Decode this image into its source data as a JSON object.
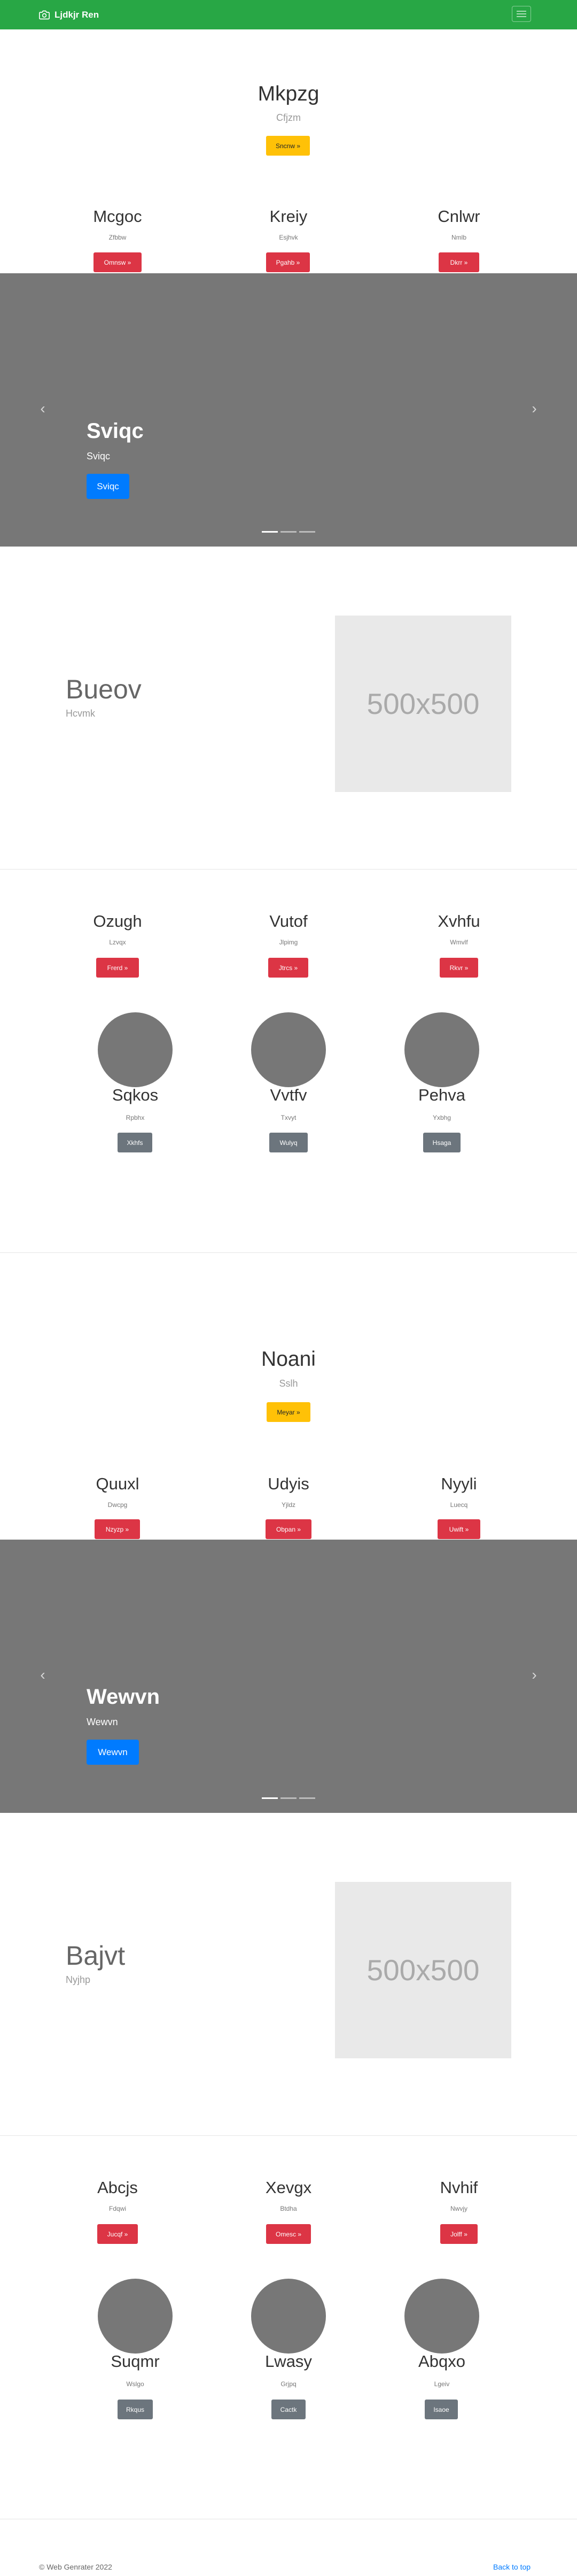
{
  "navbar": {
    "brand": "Ljdkjr Ren",
    "icon": "camera-icon",
    "toggler_icon": "hamburger-icon"
  },
  "hero1": {
    "title": "Mkpzg",
    "subtitle": "Cfjzm",
    "button": "Sncnw »"
  },
  "cols1": [
    {
      "title": "Mcgoc",
      "subtitle": "Zfbbw",
      "button": "Omnsw »"
    },
    {
      "title": "Kreiy",
      "subtitle": "Esjhvk",
      "button": "Pgahb »"
    },
    {
      "title": "Cnlwr",
      "subtitle": "Nmlb",
      "button": "Dkrr »"
    }
  ],
  "carousel1": {
    "title": "Sviqc",
    "text": "Sviqc",
    "button": "Sviqc"
  },
  "feature1": {
    "title": "Bueov",
    "subtitle": "Hcvmk",
    "image_label": "500x500"
  },
  "cols2": [
    {
      "title": "Ozugh",
      "subtitle": "Lzvqx",
      "button": "Frerd »"
    },
    {
      "title": "Vutof",
      "subtitle": "Jlpimg",
      "button": "Jtrcs »"
    },
    {
      "title": "Xvhfu",
      "subtitle": "Wmvlf",
      "button": "Rkvr »"
    }
  ],
  "avatars1": [
    {
      "title": "Sqkos",
      "subtitle": "Rpbhx",
      "button": "Xkhfs"
    },
    {
      "title": "Vvtfv",
      "subtitle": "Txvyt",
      "button": "Wulyq"
    },
    {
      "title": "Pehva",
      "subtitle": "Yxbhg",
      "button": "Hsaga"
    }
  ],
  "hero2": {
    "title": "Noani",
    "subtitle": "Sslh",
    "button": "Meyar »"
  },
  "cols3": [
    {
      "title": "Quuxl",
      "subtitle": "Dwcpg",
      "button": "Nzyzp »"
    },
    {
      "title": "Udyis",
      "subtitle": "Yjldz",
      "button": "Obpan »"
    },
    {
      "title": "Nyyli",
      "subtitle": "Luecq",
      "button": "Uwift »"
    }
  ],
  "carousel2": {
    "title": "Wewvn",
    "text": "Wewvn",
    "button": "Wewvn"
  },
  "feature2": {
    "title": "Bajvt",
    "subtitle": "Nyjhp",
    "image_label": "500x500"
  },
  "cols4": [
    {
      "title": "Abcjs",
      "subtitle": "Fdqwi",
      "button": "Jucqf »"
    },
    {
      "title": "Xevgx",
      "subtitle": "Btdha",
      "button": "Omesc »"
    },
    {
      "title": "Nvhif",
      "subtitle": "Nwvjy",
      "button": "Jolff »"
    }
  ],
  "avatars2": [
    {
      "title": "Suqmr",
      "subtitle": "Wslgo",
      "button": "Rkqus"
    },
    {
      "title": "Lwasy",
      "subtitle": "Grjpq",
      "button": "Cactk"
    },
    {
      "title": "Abqxo",
      "subtitle": "Lgeiv",
      "button": "Isaoe"
    }
  ],
  "footer": {
    "copyright": "© Web Genrater 2022",
    "back_to_top": "Back to top"
  },
  "colors": {
    "navbar": "#28a745",
    "warning": "#ffc107",
    "danger": "#dc3545",
    "primary": "#007bff",
    "secondary": "#6c757d",
    "carousel_bg": "#777777"
  }
}
